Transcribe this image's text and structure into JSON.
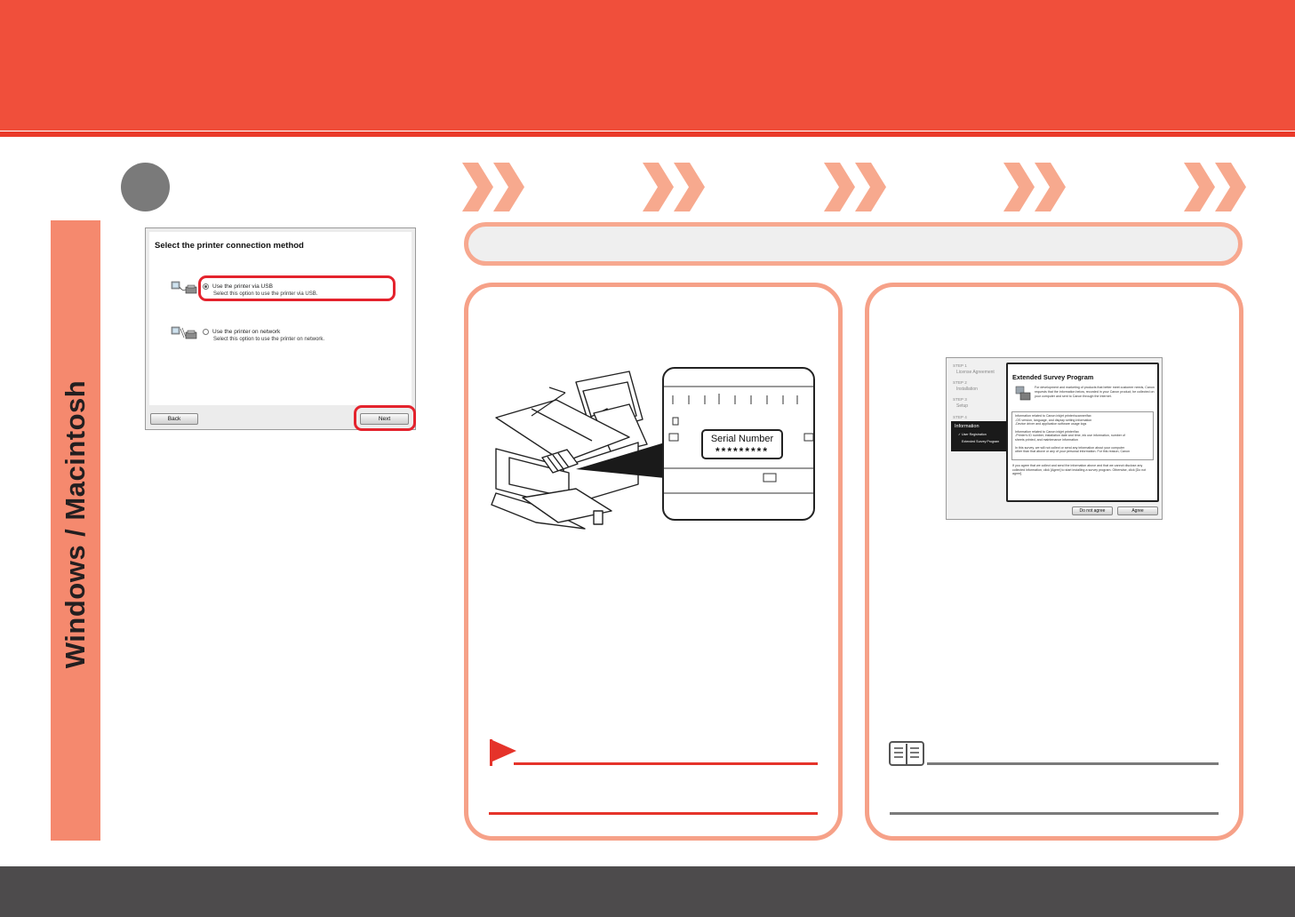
{
  "side_tab": {
    "label": "Windows / Macintosh"
  },
  "connection_dialog": {
    "title": "Select the printer connection method",
    "options": [
      {
        "label": "Use the printer via USB",
        "description": "Select this option to use the printer via USB.",
        "selected": true
      },
      {
        "label": "Use the printer on network",
        "description": "Select this option to use the printer on network.",
        "selected": false
      }
    ],
    "back_label": "Back",
    "next_label": "Next"
  },
  "serial_callout": {
    "label": "Serial Number",
    "value": "*********"
  },
  "survey_dialog": {
    "steps": [
      {
        "step": "STEP 1",
        "name": "License Agreement"
      },
      {
        "step": "STEP 2",
        "name": "Installation"
      },
      {
        "step": "STEP 3",
        "name": "Setup"
      },
      {
        "step": "STEP 4",
        "name": "Information"
      }
    ],
    "substeps": [
      "✓ User Registration",
      "Extended Survey Program"
    ],
    "title": "Extended Survey Program",
    "intro": "For development and marketing of products that better meet customer needs, Canon requests that the information below, recorded in your Canon product, be collected on your computer and sent to Canon through the Internet.",
    "list_lines": [
      "Information related to Canon inkjet printer/scanner/fax",
      "-OS version, language, and display setting information",
      "-Device driver and application software usage logs",
      "",
      "Information related to Canon inkjet printer/fax",
      "-Printer's ID number, installation date and time, ink use information, number of",
      "sheets printed, and maintenance information",
      "",
      "In this survey, we will not collect or send any information about your computer",
      "other than that above or any of your personal information. For this reason, Canon"
    ],
    "outro": "If you agree that we collect and send the information above and that we cannot disclose any collected information, click [Agree] to start installing a survey program. Otherwise, click [Do not agree].",
    "do_not_agree_label": "Do not agree",
    "agree_label": "Agree"
  },
  "colors": {
    "header": "#f04f3b",
    "accent_salmon": "#f6a188",
    "chevron": "#f7a98e",
    "footer": "#4d4b4c",
    "highlight_red": "#e4232d"
  }
}
